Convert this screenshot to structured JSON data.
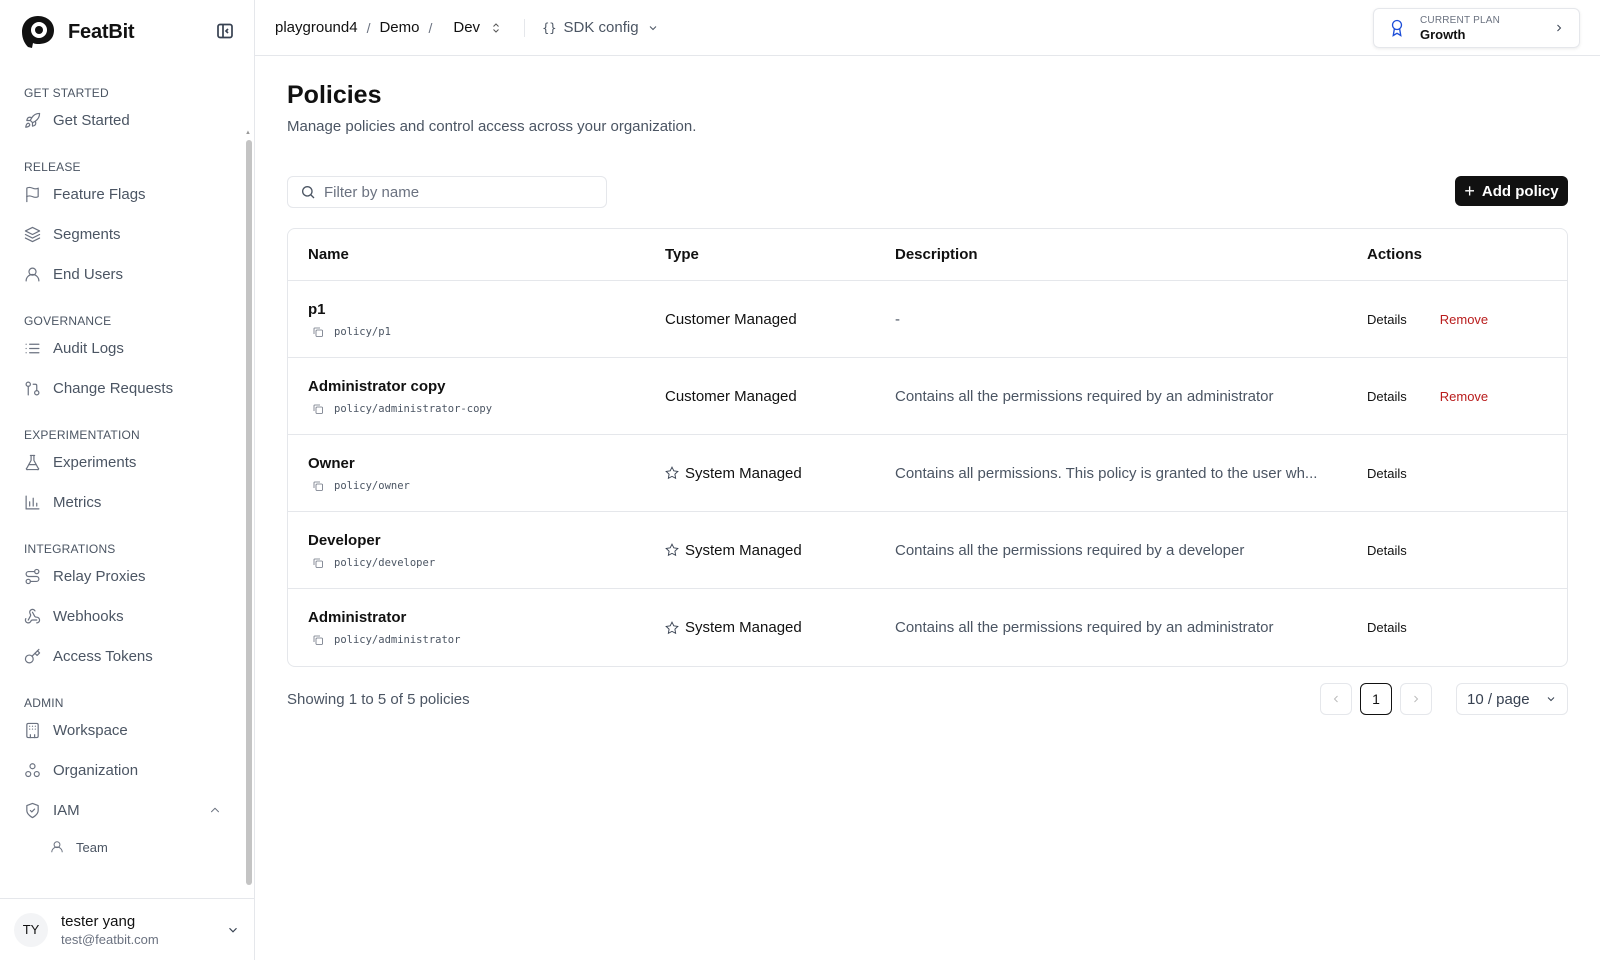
{
  "app": {
    "name": "FeatBit"
  },
  "sidebar": {
    "sections": [
      {
        "title": "GET STARTED",
        "items": [
          {
            "label": "Get Started",
            "icon": "rocket-icon"
          }
        ]
      },
      {
        "title": "RELEASE",
        "items": [
          {
            "label": "Feature Flags",
            "icon": "flag-icon"
          },
          {
            "label": "Segments",
            "icon": "layers-icon"
          },
          {
            "label": "End Users",
            "icon": "user-icon"
          }
        ]
      },
      {
        "title": "GOVERNANCE",
        "items": [
          {
            "label": "Audit Logs",
            "icon": "list-icon"
          },
          {
            "label": "Change Requests",
            "icon": "git-pull-request-icon"
          }
        ]
      },
      {
        "title": "EXPERIMENTATION",
        "items": [
          {
            "label": "Experiments",
            "icon": "flask-icon"
          },
          {
            "label": "Metrics",
            "icon": "bar-chart-icon"
          }
        ]
      },
      {
        "title": "INTEGRATIONS",
        "items": [
          {
            "label": "Relay Proxies",
            "icon": "route-icon"
          },
          {
            "label": "Webhooks",
            "icon": "webhook-icon"
          },
          {
            "label": "Access Tokens",
            "icon": "key-icon"
          }
        ]
      },
      {
        "title": "ADMIN",
        "items": [
          {
            "label": "Workspace",
            "icon": "building-icon"
          },
          {
            "label": "Organization",
            "icon": "org-icon"
          },
          {
            "label": "IAM",
            "icon": "shield-icon"
          }
        ]
      }
    ],
    "iam_sub": {
      "label": "Team"
    }
  },
  "user": {
    "initials": "TY",
    "name": "tester yang",
    "email": "test@featbit.com"
  },
  "topbar": {
    "org": "playground4",
    "project": "Demo",
    "env": "Dev",
    "sdk_label": "SDK config",
    "sdk_icon": "{}"
  },
  "plan": {
    "label": "CURRENT PLAN",
    "value": "Growth"
  },
  "page": {
    "title": "Policies",
    "subtitle": "Manage policies and control access across your organization.",
    "search_placeholder": "Filter by name",
    "add_label": "Add policy"
  },
  "table": {
    "headers": {
      "name": "Name",
      "type": "Type",
      "description": "Description",
      "actions": "Actions"
    },
    "rows": [
      {
        "name": "p1",
        "id": "policy/p1",
        "type": "Customer Managed",
        "system": false,
        "description": "-",
        "details": "Details",
        "remove": "Remove"
      },
      {
        "name": "Administrator copy",
        "id": "policy/administrator-copy",
        "type": "Customer Managed",
        "system": false,
        "description": "Contains all the permissions required by an administrator",
        "details": "Details",
        "remove": "Remove"
      },
      {
        "name": "Owner",
        "id": "policy/owner",
        "type": "System Managed",
        "system": true,
        "description": "Contains all permissions. This policy is granted to the user wh...",
        "details": "Details"
      },
      {
        "name": "Developer",
        "id": "policy/developer",
        "type": "System Managed",
        "system": true,
        "description": "Contains all the permissions required by a developer",
        "details": "Details"
      },
      {
        "name": "Administrator",
        "id": "policy/administrator",
        "type": "System Managed",
        "system": true,
        "description": "Contains all the permissions required by an administrator",
        "details": "Details"
      }
    ]
  },
  "footer": {
    "showing": "Showing 1 to 5 of 5 policies",
    "current_page": "1",
    "per_page": "10 / page"
  },
  "colors": {
    "primary": "#111111",
    "danger": "#b91c1c",
    "plan_icon": "#1d4ed8"
  }
}
